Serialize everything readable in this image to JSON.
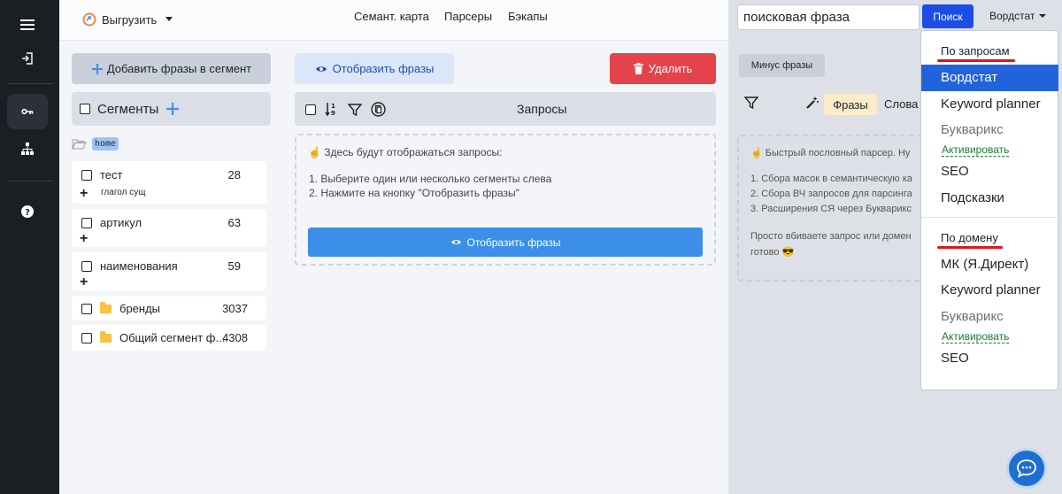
{
  "topbar": {
    "export_label": "Выгрузить",
    "nav": [
      "Семант. карта",
      "Парсеры",
      "Бэкапы"
    ]
  },
  "segments": {
    "add_button": "Добавить фразы в сегмент",
    "header": "Сегменты",
    "home_tag": "home",
    "items": [
      {
        "name": "тест",
        "count": "28",
        "sub": "глагол  сущ",
        "folder": false,
        "plus": true
      },
      {
        "name": "артикул",
        "count": "63",
        "sub": "",
        "folder": false,
        "plus": true
      },
      {
        "name": "наименования",
        "count": "59",
        "sub": "",
        "folder": false,
        "plus": true
      },
      {
        "name": "бренды",
        "count": "3037",
        "sub": "",
        "folder": true,
        "plus": false
      },
      {
        "name": "Общий сегмент ф...",
        "count": "4308",
        "sub": "",
        "folder": true,
        "plus": false
      }
    ]
  },
  "queries": {
    "show_button": "Отобразить фразы",
    "delete_button": "Удалить",
    "header": "Запросы",
    "hint": "☝️ Здесь будут отображаться запросы:",
    "steps": [
      "1. Выберите один или несколько сегменты слева",
      "2. Нажмите на кнопку \"Отобразить фразы\""
    ],
    "show_main_button": "Отобразить фразы"
  },
  "right": {
    "search_value": "поисковая фраза",
    "search_button": "Поиск",
    "source_toggle": "Вордстат",
    "minus_button": "Минус фразы",
    "tab_phrases": "Фразы",
    "tab_words": "Слова",
    "info_lines": [
      "☝️ Быстрый пословный парсер. Ну",
      "1. Сбора масок в семантическую ка",
      "2. Сбора ВЧ запросов для парсинга",
      "3. Расширения СЯ через Букварикс",
      "Просто вбиваете запрос или домен",
      "готово 😎"
    ]
  },
  "dropdown": {
    "section1_title": "По запросам",
    "section1_items": [
      {
        "label": "Вордстат",
        "selected": true,
        "gray": false
      },
      {
        "label": "Keyword planner",
        "selected": false,
        "gray": false
      },
      {
        "label": "Букварикс",
        "selected": false,
        "gray": true
      },
      {
        "label": "SEO",
        "selected": false,
        "gray": false
      },
      {
        "label": "Подсказки",
        "selected": false,
        "gray": false
      }
    ],
    "section1_activate": "Активировать",
    "section2_title": "По домену",
    "section2_items": [
      {
        "label": "МК (Я.Директ)",
        "gray": false
      },
      {
        "label": "Keyword planner",
        "gray": false
      },
      {
        "label": "Букварикс",
        "gray": true
      },
      {
        "label": "SEO",
        "gray": false
      }
    ],
    "section2_activate": "Активировать"
  },
  "colors": {
    "accent_blue": "#2263dd",
    "danger_red": "#e5434b",
    "search_button": "#1c4ee6",
    "rail_bg": "#1b1e23"
  }
}
